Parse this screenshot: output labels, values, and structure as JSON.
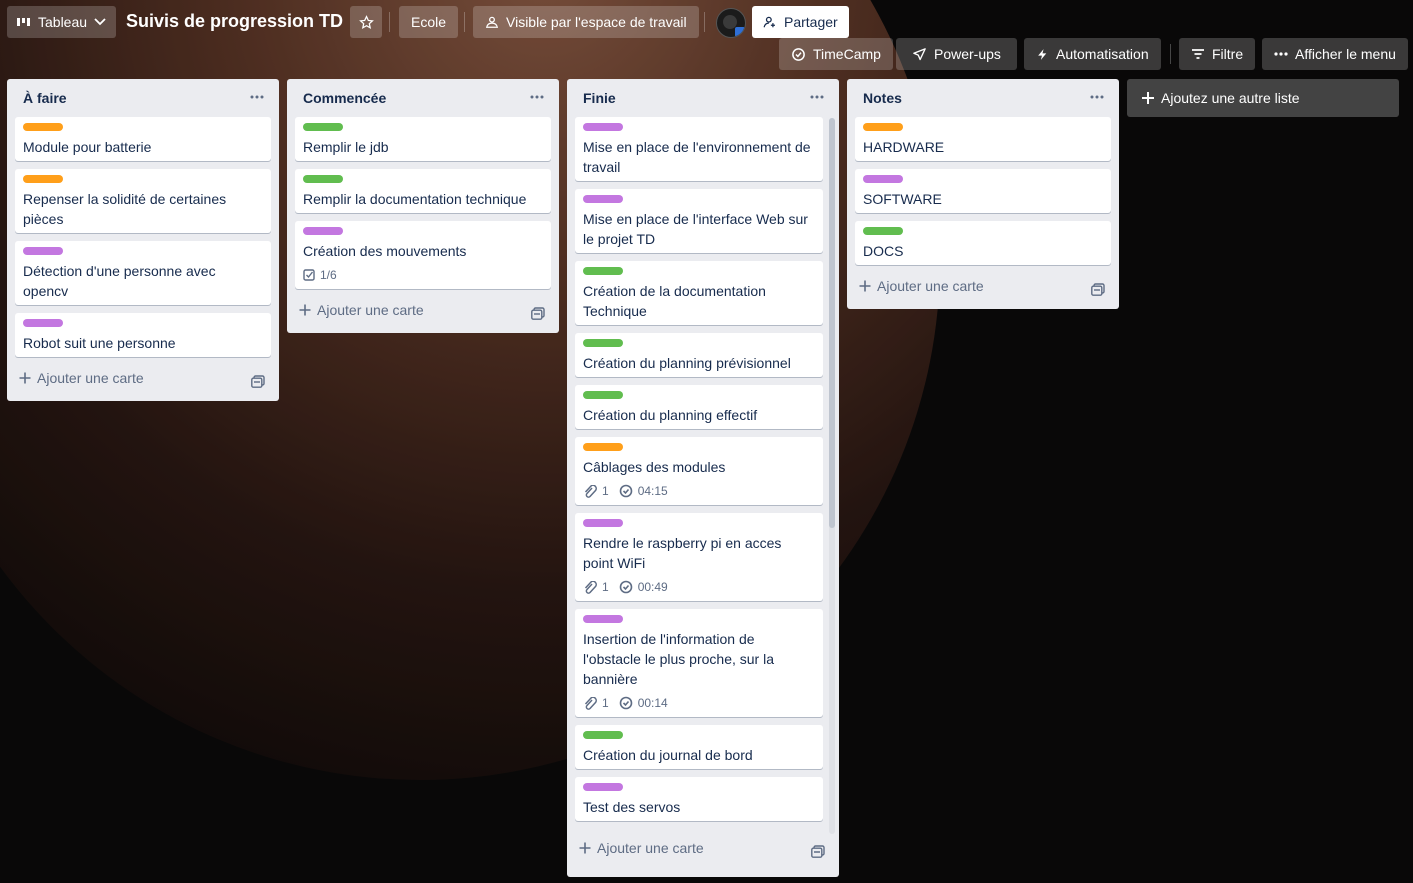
{
  "colors": {
    "orange": "#ff9f1a",
    "green": "#61bd4f",
    "purple": "#c377e0",
    "list_bg": "#ebecf0"
  },
  "header": {
    "view_switcher": {
      "label": "Tableau",
      "icon": "board-view-icon"
    },
    "board_title": "Suivis de progression TD",
    "star_icon": "star-icon",
    "workspace": "Ecole",
    "visibility": {
      "label": "Visible par l'espace de travail",
      "icon": "people-icon"
    },
    "share": {
      "label": "Partager",
      "icon": "add-member-icon"
    },
    "timecamp": "TimeCamp",
    "powerups": "Power-ups",
    "automation": "Automatisation",
    "filter": "Filtre",
    "menu": "Afficher le menu"
  },
  "add_card_label": "Ajouter une carte",
  "add_list_label": "Ajoutez une autre liste",
  "lists": [
    {
      "title": "À faire",
      "cards": [
        {
          "label_color": "orange",
          "title": "Module pour batterie"
        },
        {
          "label_color": "orange",
          "title": "Repenser la solidité de certaines pièces"
        },
        {
          "label_color": "purple",
          "title": "Détection d'une personne avec opencv"
        },
        {
          "label_color": "purple",
          "title": "Robot suit une personne"
        }
      ]
    },
    {
      "title": "Commencée",
      "cards": [
        {
          "label_color": "green",
          "title": "Remplir le jdb"
        },
        {
          "label_color": "green",
          "title": "Remplir la documentation technique"
        },
        {
          "label_color": "purple",
          "title": "Création des mouvements",
          "checklist": "1/6"
        }
      ]
    },
    {
      "title": "Finie",
      "cards": [
        {
          "label_color": "purple",
          "title": "Mise en place de l'environnement de travail"
        },
        {
          "label_color": "purple",
          "title": "Mise en place de l'interface Web sur le projet TD"
        },
        {
          "label_color": "green",
          "title": "Création de la documentation Technique"
        },
        {
          "label_color": "green",
          "title": "Création du planning prévisionnel"
        },
        {
          "label_color": "green",
          "title": "Création du planning effectif"
        },
        {
          "label_color": "orange",
          "title": "Câblages des modules",
          "attachments": "1",
          "time": "04:15"
        },
        {
          "label_color": "purple",
          "title": "Rendre le raspberry pi en acces point WiFi",
          "attachments": "1",
          "time": "00:49"
        },
        {
          "label_color": "purple",
          "title": "Insertion de l'information de l'obstacle le plus proche, sur la bannière",
          "attachments": "1",
          "time": "00:14"
        },
        {
          "label_color": "green",
          "title": "Création du journal de bord"
        },
        {
          "label_color": "purple",
          "title": "Test des servos"
        }
      ]
    },
    {
      "title": "Notes",
      "cards": [
        {
          "label_color": "orange",
          "title": "HARDWARE"
        },
        {
          "label_color": "purple",
          "title": "SOFTWARE"
        },
        {
          "label_color": "green",
          "title": "DOCS"
        }
      ]
    }
  ]
}
